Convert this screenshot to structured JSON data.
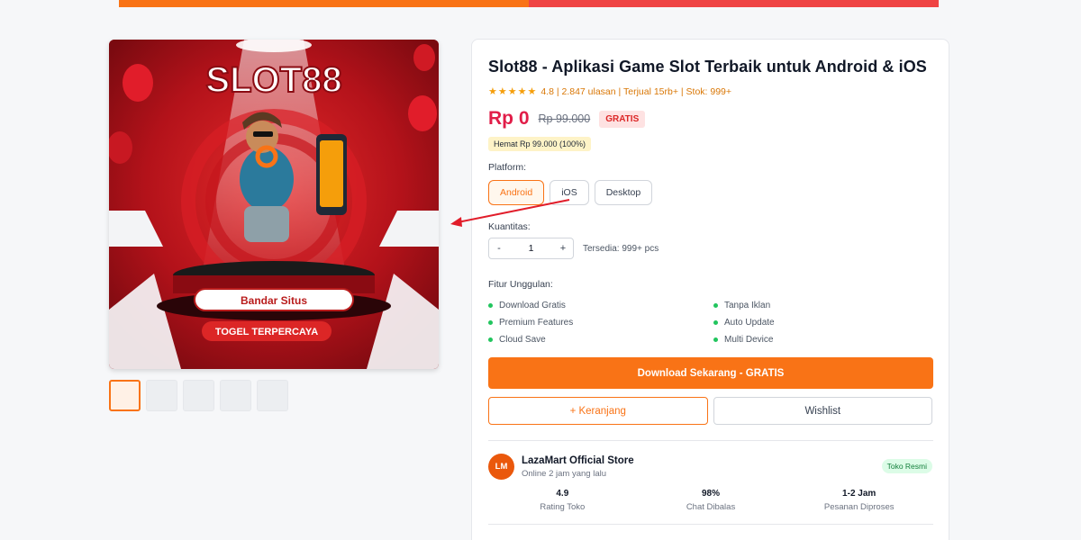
{
  "image": {
    "brand": "SLOT88",
    "banner_top": "Bandar Situs",
    "banner_bottom": "TOGEL TERPERCAYA"
  },
  "product": {
    "title": "Slot88 - Aplikasi Game Slot Terbaik untuk Android & iOS",
    "stars": "★★★★★",
    "meta": "4.8 | 2.847 ulasan | Terjual 15rb+ | Stok: 999+",
    "price": "Rp 0",
    "old_price": "Rp 99.000",
    "badge": "GRATIS",
    "saving": "Hemat Rp 99.000 (100%)"
  },
  "platform": {
    "label": "Platform:",
    "options": [
      "Android",
      "iOS",
      "Desktop"
    ],
    "selected": "Android"
  },
  "quantity": {
    "label": "Kuantitas:",
    "minus": "-",
    "value": "1",
    "plus": "+",
    "stock": "Tersedia: 999+ pcs"
  },
  "features": {
    "label": "Fitur Unggulan:",
    "items": [
      "Download Gratis",
      "Tanpa Iklan",
      "Premium Features",
      "Auto Update",
      "Cloud Save",
      "Multi Device"
    ]
  },
  "actions": {
    "download": "Download Sekarang - GRATIS",
    "cart": "+ Keranjang",
    "wishlist": "Wishlist"
  },
  "store": {
    "initials": "LM",
    "name": "LazaMart Official Store",
    "status": "Online 2 jam yang lalu",
    "badge": "Toko Resmi",
    "stats": [
      {
        "value": "4.9",
        "label": "Rating Toko"
      },
      {
        "value": "98%",
        "label": "Chat Dibalas"
      },
      {
        "value": "1-2 Jam",
        "label": "Pesanan Diproses"
      }
    ]
  },
  "colors": {
    "accent": "#f97316",
    "price": "#e11d48",
    "banner_red": "#b3121a"
  }
}
